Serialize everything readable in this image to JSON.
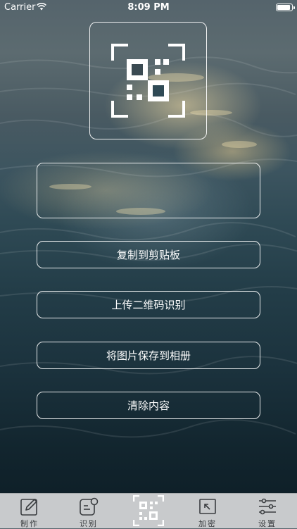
{
  "status_bar": {
    "carrier": "Carrier",
    "time": "8:09 PM"
  },
  "result": {
    "text": ""
  },
  "buttons": {
    "copy": "复制到剪贴板",
    "upload": "上传二维码识别",
    "save": "将图片保存到相册",
    "clear": "清除内容"
  },
  "tabs": [
    {
      "label": "制作",
      "icon": "pencil-icon"
    },
    {
      "label": "识别",
      "icon": "scan-document-icon"
    },
    {
      "label": "",
      "icon": "qr-code-icon"
    },
    {
      "label": "加密",
      "icon": "encrypt-arrow-icon"
    },
    {
      "label": "设置",
      "icon": "sliders-icon"
    }
  ],
  "colors": {
    "tabbar_bg": "#c8cacc",
    "border": "#ffffff"
  }
}
